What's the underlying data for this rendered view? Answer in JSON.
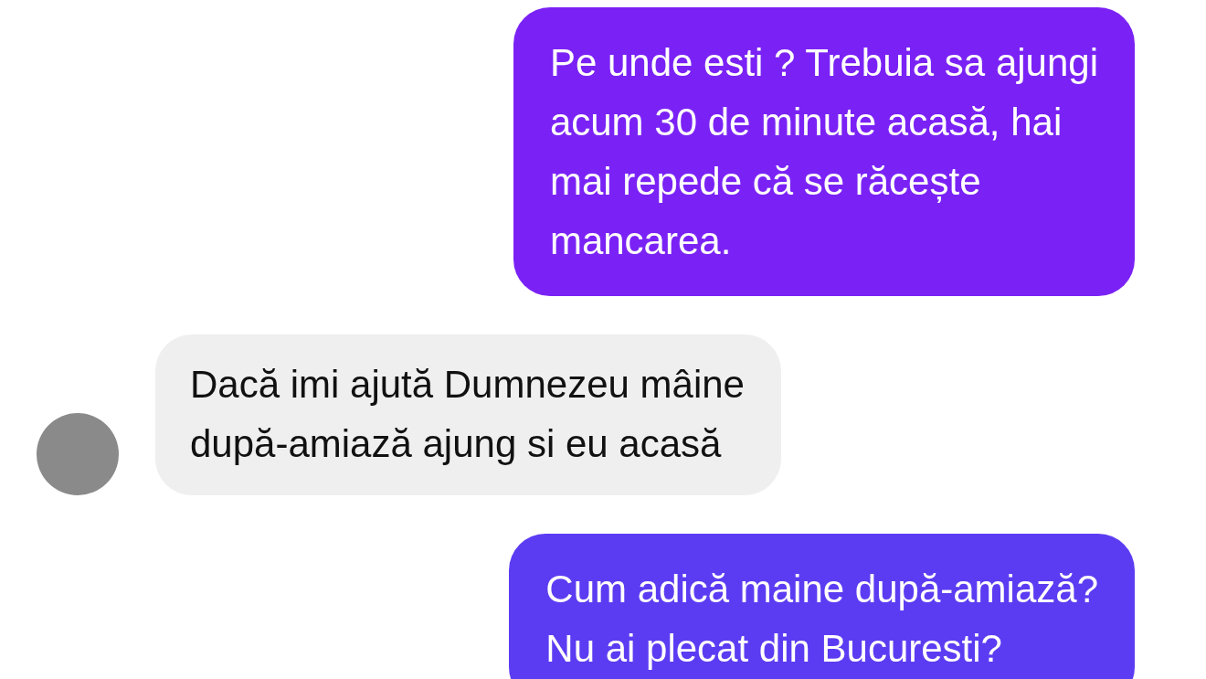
{
  "messages": [
    {
      "kind": "sent",
      "text": "Pe unde esti ? Trebuia sa ajungi\nacum 30 de minute acasă, hai\nmai repede că se răcește\nmancarea.",
      "color": "#7a22f5"
    },
    {
      "kind": "received",
      "text": "Dacă imi ajută Dumnezeu mâine\ndupă-amiază ajung si eu acasă",
      "color": "#efeff0"
    },
    {
      "kind": "sent",
      "text": "Cum adică maine după-amiază?\nNu ai plecat din Bucuresti?",
      "color": "#5c3cf2"
    }
  ]
}
